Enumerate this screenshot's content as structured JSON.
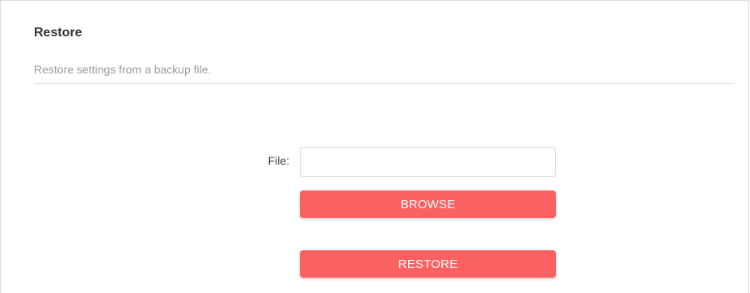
{
  "section": {
    "title": "Restore",
    "description": "Restore settings from a backup file."
  },
  "file_field": {
    "label": "File:",
    "value": "",
    "placeholder": ""
  },
  "buttons": {
    "browse_label": "BROWSE",
    "restore_label": "RESTORE"
  },
  "colors": {
    "accent": "#fb6161",
    "title_text": "#333333",
    "subtitle_text": "#9a9a9a"
  }
}
